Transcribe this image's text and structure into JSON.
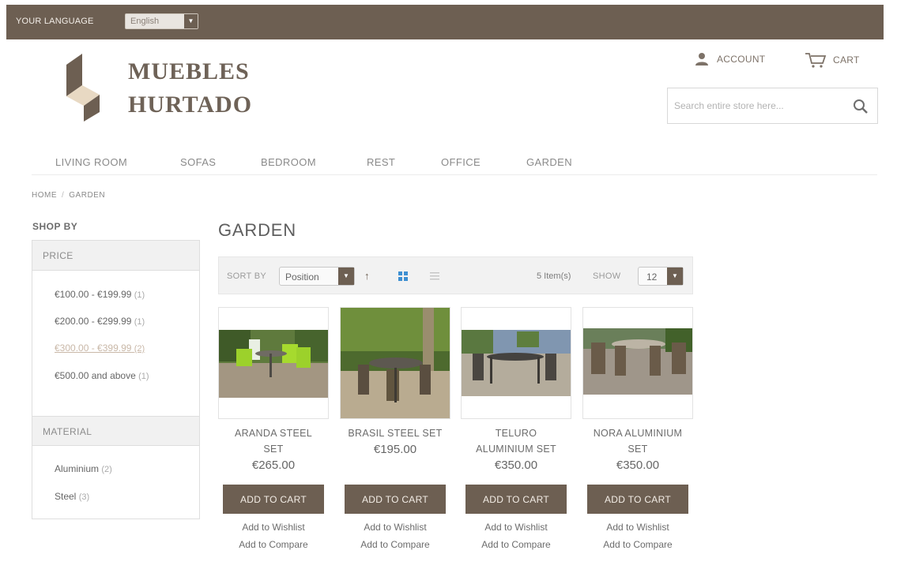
{
  "topbar": {
    "language_label": "YOUR LANGUAGE",
    "language_value": "English"
  },
  "logo": {
    "line1": "MUEBLES",
    "line2": "HURTADO"
  },
  "header": {
    "account_label": "ACCOUNT",
    "cart_label": "CART"
  },
  "search": {
    "placeholder": "Search entire store here..."
  },
  "nav": {
    "items": [
      "LIVING ROOM",
      "SOFAS",
      "BEDROOM",
      "REST",
      "OFFICE",
      "GARDEN"
    ]
  },
  "breadcrumb": {
    "home": "HOME",
    "separator": "/",
    "current": "GARDEN"
  },
  "sidebar": {
    "title": "SHOP BY",
    "price": {
      "heading": "PRICE",
      "options": [
        {
          "label": "€100.00 - €199.99",
          "count": "(1)"
        },
        {
          "label": "€200.00 - €299.99",
          "count": "(1)"
        },
        {
          "label": "€300.00 - €399.99",
          "count": "(2)"
        },
        {
          "label": "€500.00 and above",
          "count": "(1)"
        }
      ]
    },
    "material": {
      "heading": "MATERIAL",
      "options": [
        {
          "label": "Aluminium",
          "count": "(2)"
        },
        {
          "label": "Steel",
          "count": "(3)"
        }
      ]
    }
  },
  "category": {
    "title": "GARDEN"
  },
  "toolbar": {
    "sort_label": "SORT BY",
    "sort_value": "Position",
    "sort_direction": "↑",
    "items_count": "5 Item(s)",
    "show_label": "SHOW",
    "show_value": "12"
  },
  "products": [
    {
      "name_line1": "ARANDA STEEL",
      "name_line2": "SET",
      "price": "€265.00",
      "add_to_cart": "ADD TO CART",
      "wishlist": "Add to Wishlist",
      "compare": "Add to Compare"
    },
    {
      "name_line1": "BRASIL STEEL SET",
      "name_line2": "",
      "price": "€195.00",
      "add_to_cart": "ADD TO CART",
      "wishlist": "Add to Wishlist",
      "compare": "Add to Compare"
    },
    {
      "name_line1": "TELURO",
      "name_line2": "ALUMINIUM SET",
      "price": "€350.00",
      "add_to_cart": "ADD TO CART",
      "wishlist": "Add to Wishlist",
      "compare": "Add to Compare"
    },
    {
      "name_line1": "NORA ALUMINIUM",
      "name_line2": "SET",
      "price": "€350.00",
      "add_to_cart": "ADD TO CART",
      "wishlist": "Add to Wishlist",
      "compare": "Add to Compare"
    }
  ],
  "colors": {
    "brand": "#6d5f52",
    "accent_link_active": "#c9b8a8"
  }
}
